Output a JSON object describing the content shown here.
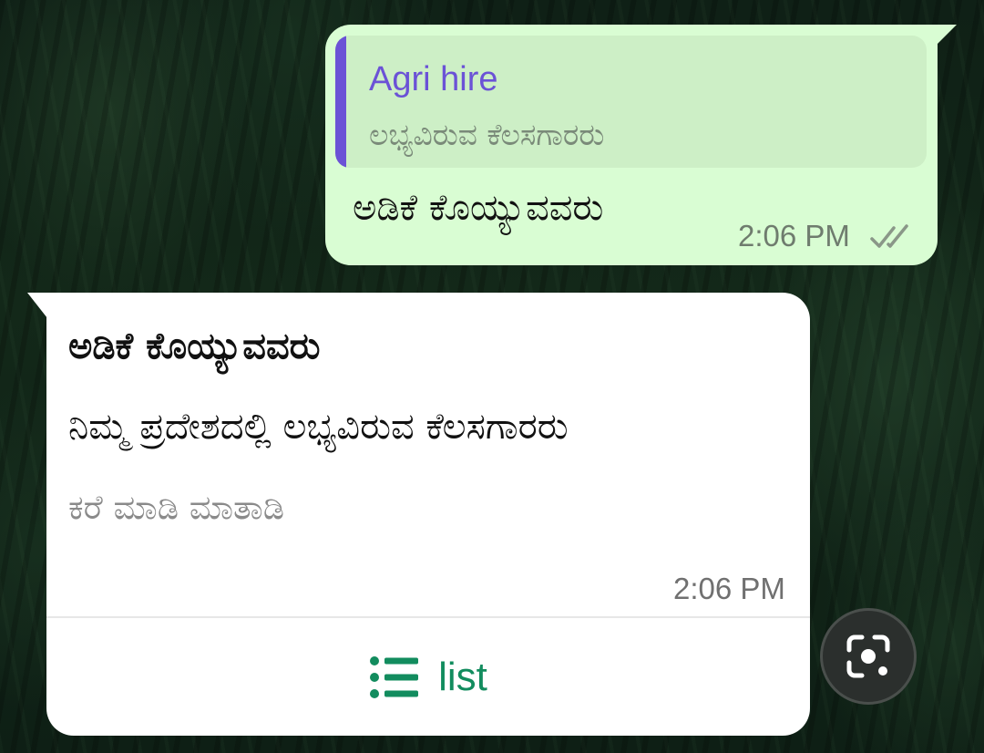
{
  "outgoing": {
    "quote": {
      "author": "Agri hire",
      "text": "ಲಭ್ಯವಿರುವ ಕೆಲಸಗಾರರು"
    },
    "text": "ಅಡಿಕೆ ಕೊಯ್ಯುವವರು",
    "time": "2:06 PM",
    "status_icon": "double-check-icon"
  },
  "incoming": {
    "title": "ಅಡಿಕೆ ಕೊಯ್ಯುವವರು",
    "body": "ನಿಮ್ಮ ಪ್ರದೇಶದಲ್ಲಿ ಲಭ್ಯವಿರುವ ಕೆಲಸಗಾರರು",
    "footer": "ಕರೆ ಮಾಡಿ ಮಾತಾಡಿ",
    "time": "2:06 PM",
    "button": {
      "label": "list",
      "icon": "list-icon"
    }
  },
  "lens_button": {
    "icon": "lens-scan-icon"
  },
  "colors": {
    "outgoing_bubble": "#d9fdd3",
    "quote_accent": "#6b52d6",
    "button_accent": "#128c5e",
    "incoming_bubble": "#ffffff"
  }
}
